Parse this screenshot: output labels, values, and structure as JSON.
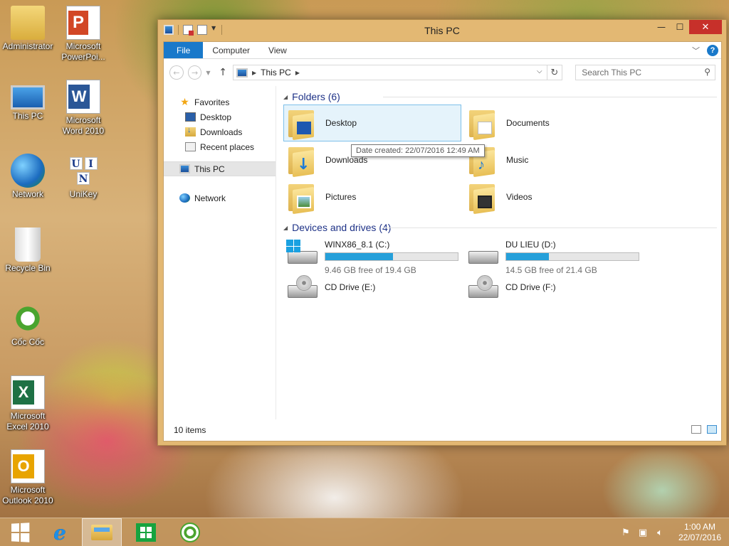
{
  "desktop": {
    "icons": [
      {
        "label_1": "Administrator",
        "label_2": "",
        "icon": "user-folder-icon"
      },
      {
        "label_1": "Microsoft",
        "label_2": "PowerPoi...",
        "icon": "powerpoint-icon"
      },
      {
        "label_1": "This PC",
        "label_2": "",
        "icon": "computer-icon"
      },
      {
        "label_1": "Microsoft",
        "label_2": "Word 2010",
        "icon": "word-icon"
      },
      {
        "label_1": "Network",
        "label_2": "",
        "icon": "network-globe-icon"
      },
      {
        "label_1": "UniKey",
        "label_2": "",
        "icon": "unikey-icon",
        "glyphs": [
          "U",
          "I",
          "N"
        ]
      },
      {
        "label_1": "Recycle Bin",
        "label_2": "",
        "icon": "recycle-bin-icon"
      },
      {
        "label_1": "Cốc Cốc",
        "label_2": "",
        "icon": "coccoc-icon"
      },
      {
        "label_1": "Microsoft",
        "label_2": "Excel 2010",
        "icon": "excel-icon"
      },
      {
        "label_1": "Microsoft",
        "label_2": "Outlook 2010",
        "icon": "outlook-icon"
      }
    ]
  },
  "window": {
    "title": "This PC",
    "controls": {
      "minimize": "—",
      "maximize": "☐",
      "close": "✕"
    },
    "ribbon": {
      "tabs": [
        "File",
        "Computer",
        "View"
      ],
      "help": "?"
    },
    "address": {
      "location": "This PC",
      "search_placeholder": "Search This PC"
    },
    "nav_pane": {
      "favorites": "Favorites",
      "favorite_items": [
        "Desktop",
        "Downloads",
        "Recent places"
      ],
      "this_pc": "This PC",
      "network": "Network"
    },
    "folders_group": {
      "title": "Folders (6)",
      "items": [
        "Desktop",
        "Documents",
        "Downloads",
        "Music",
        "Pictures",
        "Videos"
      ]
    },
    "tooltip": "Date created: 22/07/2016 12:49 AM",
    "drives_group": {
      "title": "Devices and drives (4)",
      "drives": [
        {
          "name": "WINX86_8.1 (C:)",
          "free": "9.46 GB free of 19.4 GB",
          "used_fraction": 0.512
        },
        {
          "name": "DU LIEU (D:)",
          "free": "14.5 GB free of 21.4 GB",
          "used_fraction": 0.322
        }
      ],
      "cd_drives": [
        "CD Drive (E:)",
        "CD Drive (F:)"
      ]
    },
    "status": "10 items"
  },
  "taskbar": {
    "time": "1:00 AM",
    "date": "22/07/2016"
  },
  "colors": {
    "accent": "#1979ca",
    "drive_bar": "#26a0da",
    "selection": "#e5f3fb",
    "group_heading": "#1e3287",
    "close_button": "#c7302a"
  }
}
